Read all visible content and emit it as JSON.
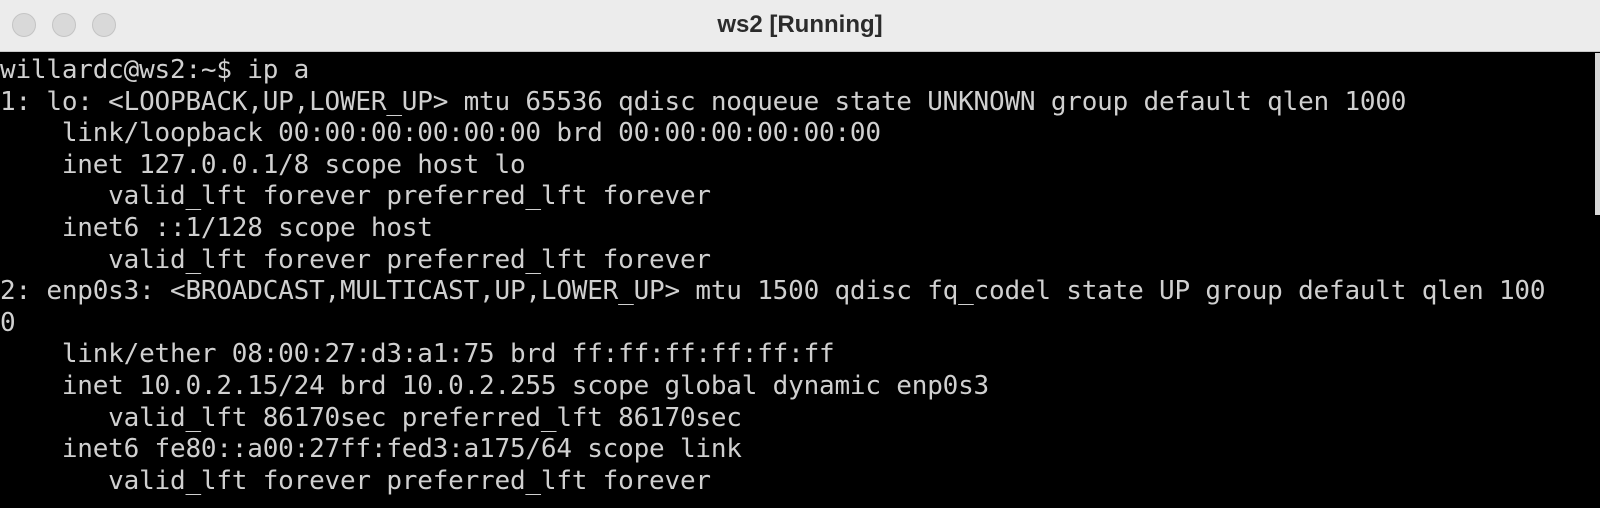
{
  "window": {
    "title": "ws2 [Running]"
  },
  "terminal": {
    "lines": [
      "willardc@ws2:~$ ip a",
      "1: lo: <LOOPBACK,UP,LOWER_UP> mtu 65536 qdisc noqueue state UNKNOWN group default qlen 1000",
      "    link/loopback 00:00:00:00:00:00 brd 00:00:00:00:00:00",
      "    inet 127.0.0.1/8 scope host lo",
      "       valid_lft forever preferred_lft forever",
      "    inet6 ::1/128 scope host",
      "       valid_lft forever preferred_lft forever",
      "2: enp0s3: <BROADCAST,MULTICAST,UP,LOWER_UP> mtu 1500 qdisc fq_codel state UP group default qlen 100",
      "0",
      "    link/ether 08:00:27:d3:a1:75 brd ff:ff:ff:ff:ff:ff",
      "    inet 10.0.2.15/24 brd 10.0.2.255 scope global dynamic enp0s3",
      "       valid_lft 86170sec preferred_lft 86170sec",
      "    inet6 fe80::a00:27ff:fed3:a175/64 scope link",
      "       valid_lft forever preferred_lft forever"
    ]
  },
  "colors": {
    "terminal_bg": "#000000",
    "terminal_fg": "#d0d0d0",
    "titlebar_bg": "#ececec"
  }
}
